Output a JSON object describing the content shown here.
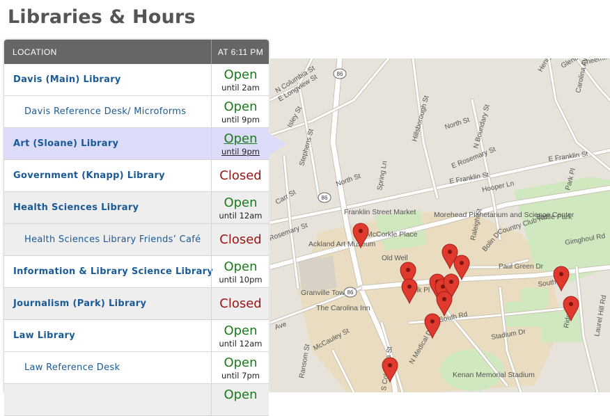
{
  "page": {
    "title": "Libraries & Hours"
  },
  "table": {
    "location_header": "LOCATION",
    "time_header": "AT 6:11 PM",
    "rows": [
      {
        "name": "Davis (Main) Library",
        "status": "Open",
        "until": "until 2am",
        "sub": false
      },
      {
        "name": "Davis Reference Desk/ Microforms",
        "status": "Open",
        "until": "until 9pm",
        "sub": true
      },
      {
        "name": "Art (Sloane) Library",
        "status": "Open",
        "until": "until 9pm",
        "sub": false,
        "selected": true
      },
      {
        "name": "Government (Knapp) Library",
        "status": "Closed",
        "until": "",
        "sub": false
      },
      {
        "name": "Health Sciences Library",
        "status": "Open",
        "until": "until 12am",
        "sub": false
      },
      {
        "name": "Health Sciences Library Friends’ Café",
        "status": "Closed",
        "until": "",
        "sub": true
      },
      {
        "name": "Information & Library Science Library",
        "status": "Open",
        "until": "until 10pm",
        "sub": false
      },
      {
        "name": "Journalism (Park) Library",
        "status": "Closed",
        "until": "",
        "sub": false
      },
      {
        "name": "Law Library",
        "status": "Open",
        "until": "until 12am",
        "sub": false
      },
      {
        "name": "Law Reference Desk",
        "status": "Open",
        "until": "until 7pm",
        "sub": true
      },
      {
        "name": "",
        "status": "Open",
        "until": "",
        "sub": false
      }
    ]
  },
  "map": {
    "street_labels": [
      "N Columbia St",
      "E Longview St",
      "Isley St",
      "Stephens St",
      "Hillsborough St",
      "N Boundary St",
      "North St",
      "E Rosemary St",
      "E Franklin St",
      "E Franklin St",
      "Hooper Ln",
      "Park Pl",
      "Carolina Ave",
      "Spring Ln",
      "North St",
      "Carr St",
      "Rosemary St",
      "Country Club Rd",
      "Gimghoul Rd",
      "Paul Green Dr",
      "South Rd",
      "South Rd",
      "Raleigh St",
      "Stadium Dr",
      "McCauley St",
      "Ransom St",
      "S Columbia St",
      "N Medical Dr",
      "Ridge Rd",
      "Laurel Hill Rd",
      "Henry Cir",
      "Glenburnie St",
      "Cheeming Rd",
      "Ave",
      "Old Well",
      "Polk Pl",
      "Bolin Dr"
    ],
    "place_labels": [
      "Franklin Street Market",
      "McCorkle Place",
      "Morehead Planetarium and Science Center",
      "Battle Park",
      "Ackland Art Museum",
      "Granville Towers",
      "The Carolina Inn",
      "Kenan Memorial Stadium"
    ],
    "route_shields": [
      "86",
      "86",
      "86"
    ],
    "marker_count": 13,
    "colors": {
      "land": "#e8e3da",
      "campus": "#e9dcc0",
      "park": "#cfe8c0",
      "road": "#ffffff",
      "marker": "#e03a2e"
    }
  }
}
